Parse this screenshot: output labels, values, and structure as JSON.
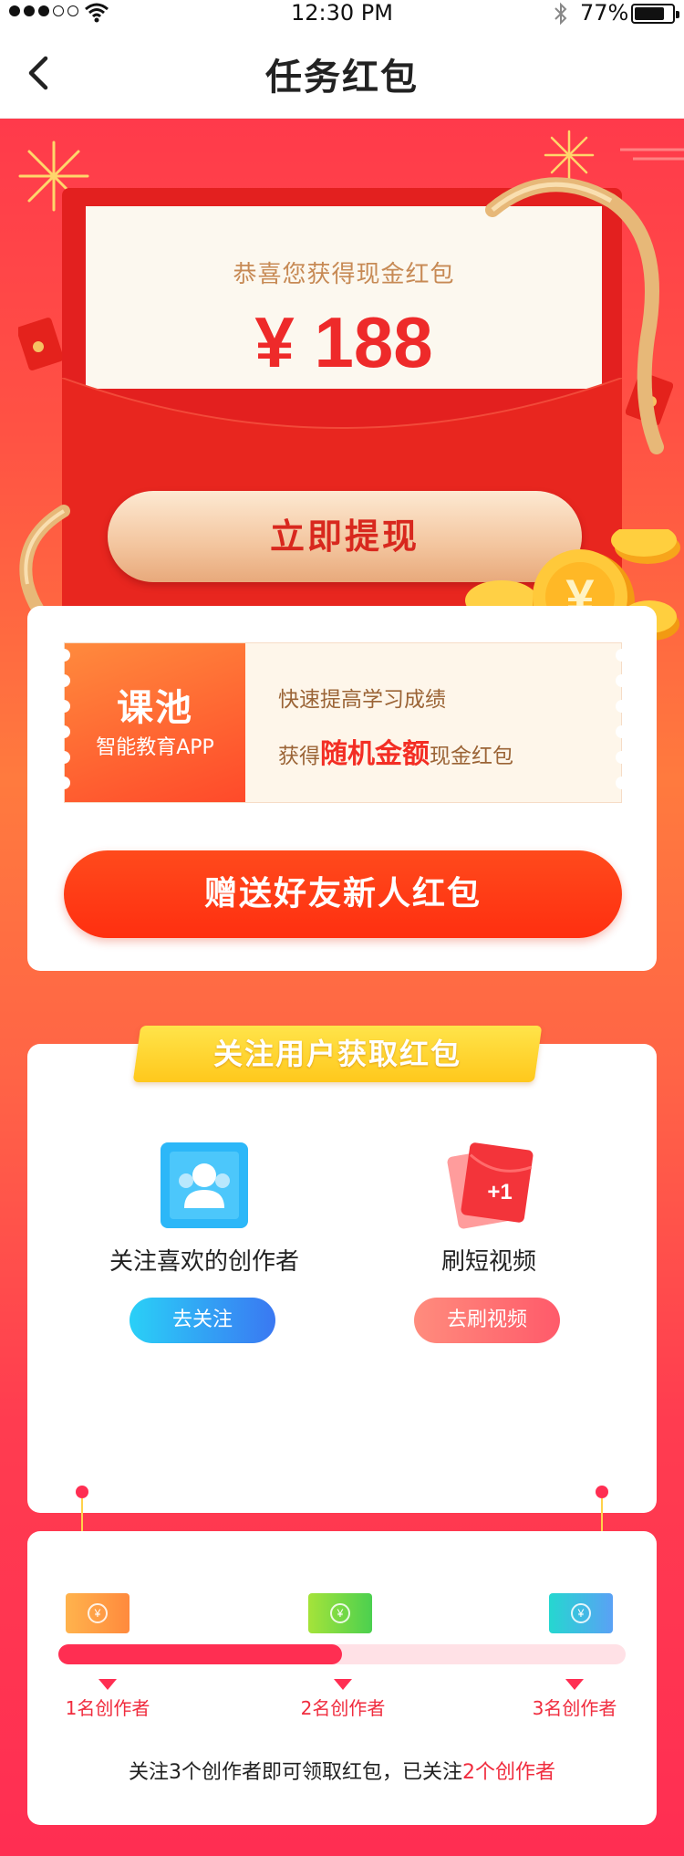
{
  "status_bar": {
    "time": "12:30 PM",
    "battery": "77%"
  },
  "nav": {
    "title": "任务红包"
  },
  "envelope": {
    "congrats": "恭喜您获得现金红包",
    "amount": "¥ 188",
    "withdraw_label": "立即提现"
  },
  "promo": {
    "brand": "课池",
    "subtitle": "智能教育APP",
    "line1": "快速提高学习成绩",
    "line2_prefix": "获得",
    "line2_highlight": "随机金额",
    "line2_suffix": "现金红包",
    "gift_button": "赠送好友新人红包"
  },
  "follow": {
    "title": "关注用户获取红包",
    "tasks": [
      {
        "label": "关注喜欢的创作者",
        "button": "去关注",
        "icon": "user-follow-icon"
      },
      {
        "label": "刷短视频",
        "button": "去刷视频",
        "icon": "red-envelope-plus-one-icon",
        "badge": "+1"
      }
    ]
  },
  "progress": {
    "steps": [
      "1名创作者",
      "2名创作者",
      "3名创作者"
    ],
    "fraction": 0.5,
    "summary_prefix": "关注3个创作者即可领取红包，已关注",
    "summary_highlight": "2个创作者"
  },
  "colors": {
    "accent": "#ff2e52",
    "button_orange": "#ff3a14",
    "gold": "#f3c59e"
  }
}
